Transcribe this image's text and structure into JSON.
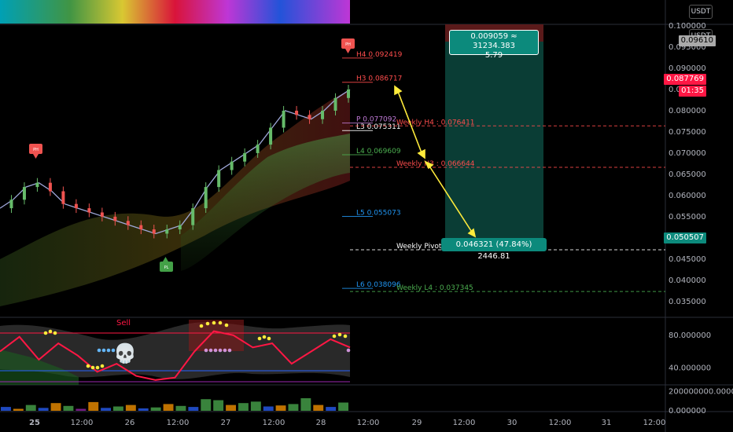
{
  "currency_badge": "USDT",
  "price_tags": {
    "current_top": "0.09610",
    "last_price": "0.087769",
    "countdown": "01:35",
    "target_price": "0.050507"
  },
  "callouts": {
    "top_line1": "0.009059 ≈ 31234.383",
    "top_line2": "5.79",
    "bottom": "0.046321 (47.84%) 2446.81"
  },
  "markers": {
    "sell_label": "Sell",
    "skull_icon": "💀",
    "pivot_high_label": "PH",
    "pivot_low_label": "PL"
  },
  "levels": [
    {
      "label": "H4 0.092419",
      "value": 0.092419,
      "color": "#ff4d4d"
    },
    {
      "label": "H3 0.086717",
      "value": 0.086717,
      "color": "#ff4d4d"
    },
    {
      "label": "P 0.077092",
      "value": 0.077092,
      "color": "#c27bd8"
    },
    {
      "label": "L3 0.075311",
      "value": 0.075311,
      "color": "#ffffff"
    },
    {
      "label": "L4 0.069609",
      "value": 0.069609,
      "color": "#4caf50"
    },
    {
      "label": "L5 0.055073",
      "value": 0.055073,
      "color": "#2196f3"
    },
    {
      "label": "L6 0.038096",
      "value": 0.038096,
      "color": "#2196f3"
    },
    {
      "label": "Weekly H4 : 0.076411",
      "value": 0.076411,
      "color": "#ff4d4d"
    },
    {
      "label": "Weekly H3 : 0.066644",
      "value": 0.066644,
      "color": "#ff4d4d"
    },
    {
      "label": "Weekly Pivot : 0.04",
      "value": 0.0472,
      "color": "#ffffff"
    },
    {
      "label": "Weekly L4 : 0.037345",
      "value": 0.037345,
      "color": "#4caf50"
    }
  ],
  "chart_data": [
    {
      "type": "line",
      "title": "",
      "ylim": [
        0.032,
        0.1
      ],
      "y_ticks": [
        "0.100000",
        "0.095000",
        "0.090000",
        "0.085000",
        "0.080000",
        "0.075000",
        "0.070000",
        "0.065000",
        "0.060000",
        "0.055000",
        "0.050000",
        "0.045000",
        "0.040000",
        "0.035000"
      ],
      "y_tick_values": [
        0.1,
        0.095,
        0.09,
        0.085,
        0.08,
        0.075,
        0.07,
        0.065,
        0.06,
        0.055,
        0.05,
        0.045,
        0.04,
        0.035
      ],
      "series": [
        {
          "x": [
            0,
            4,
            8,
            12,
            16,
            20,
            24,
            28,
            32,
            36,
            40,
            44,
            48,
            52,
            56,
            60,
            64,
            68,
            72,
            76,
            80,
            84,
            88,
            92,
            96,
            100,
            104,
            108
          ],
          "values": [
            0.057,
            0.059,
            0.062,
            0.063,
            0.061,
            0.058,
            0.057,
            0.056,
            0.055,
            0.054,
            0.053,
            0.052,
            0.051,
            0.052,
            0.053,
            0.057,
            0.062,
            0.066,
            0.068,
            0.07,
            0.072,
            0.076,
            0.08,
            0.079,
            0.078,
            0.08,
            0.083,
            0.085
          ]
        }
      ]
    },
    {
      "type": "line",
      "title": "",
      "ylim": [
        20,
        100
      ],
      "y_ticks": [
        "80.000000",
        "40.000000"
      ],
      "y_tick_values": [
        80,
        40
      ],
      "series": [
        {
          "x": [
            0,
            6,
            12,
            18,
            24,
            30,
            36,
            42,
            48,
            54,
            60,
            66,
            72,
            78,
            84,
            90,
            96,
            102,
            108
          ],
          "values": [
            60,
            78,
            50,
            70,
            55,
            35,
            45,
            30,
            25,
            28,
            60,
            85,
            80,
            65,
            70,
            45,
            60,
            75,
            65
          ]
        }
      ]
    },
    {
      "type": "bar",
      "title": "",
      "y_ticks": [
        "200000000.000000",
        "0.000000"
      ],
      "y_tick_values": [
        200000000,
        0
      ],
      "ylim": [
        0,
        260000000
      ],
      "values": [
        40000000,
        20000000,
        60000000,
        30000000,
        80000000,
        50000000,
        20000000,
        90000000,
        30000000,
        45000000,
        60000000,
        25000000,
        35000000,
        70000000,
        50000000,
        40000000,
        120000000,
        110000000,
        60000000,
        80000000,
        95000000,
        45000000,
        55000000,
        70000000,
        130000000,
        60000000,
        40000000,
        85000000
      ],
      "colors": [
        "#2962ff",
        "#ff9800",
        "#4caf50",
        "#2962ff",
        "#ff9800",
        "#4caf50",
        "#9c27b0",
        "#ff9800",
        "#2962ff",
        "#4caf50",
        "#ff9800",
        "#2962ff",
        "#4caf50",
        "#ff9800",
        "#4caf50",
        "#2962ff",
        "#4caf50",
        "#4caf50",
        "#ff9800",
        "#4caf50",
        "#4caf50",
        "#2962ff",
        "#ff9800",
        "#4caf50",
        "#4caf50",
        "#ff9800",
        "#2962ff",
        "#4caf50"
      ]
    }
  ],
  "x_axis": {
    "labels": [
      "25",
      "12:00",
      "26",
      "12:00",
      "27",
      "12:00",
      "28",
      "12:00",
      "29",
      "12:00",
      "30",
      "12:00",
      "31",
      "12:00"
    ],
    "bold": [
      true,
      false,
      false,
      false,
      false,
      false,
      false,
      false,
      false,
      false,
      false,
      false,
      false,
      false
    ]
  },
  "colors": {
    "background": "#000000",
    "target_zone": "#0a3d35",
    "accent_yellow": "#ffeb3b",
    "price_red": "#ff1744",
    "target_green": "#0c8a7c"
  }
}
